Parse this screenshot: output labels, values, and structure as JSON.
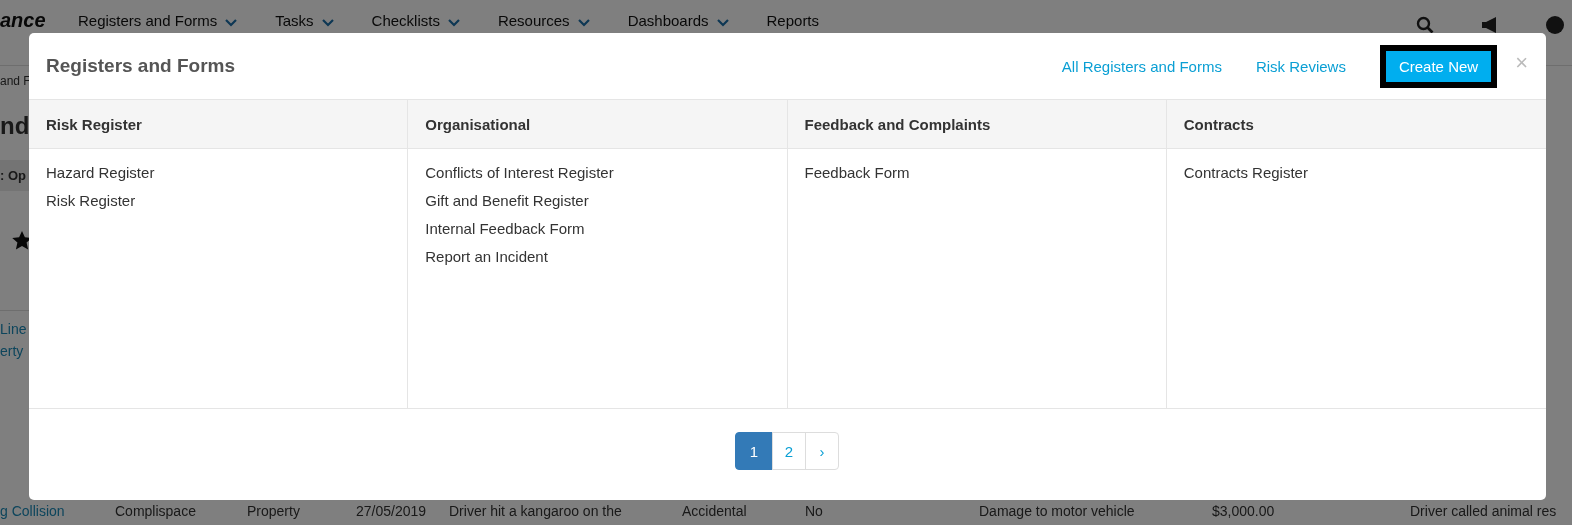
{
  "background": {
    "logo": "ance",
    "nav": [
      {
        "label": "Registers and Forms",
        "dropdown": true
      },
      {
        "label": "Tasks",
        "dropdown": true
      },
      {
        "label": "Checklists",
        "dropdown": true
      },
      {
        "label": "Resources",
        "dropdown": true
      },
      {
        "label": "Dashboards",
        "dropdown": true
      },
      {
        "label": "Reports",
        "dropdown": false
      }
    ],
    "breadcrumb": "and F",
    "heading": "nd",
    "filter": ": Op",
    "links": [
      "Line",
      "erty"
    ],
    "row": [
      "g Collision",
      "Complispace",
      "Property",
      "27/05/2019",
      "Driver hit a kangaroo on the",
      "Accidental",
      "No",
      "Damage to motor vehicle",
      "$3,000.00",
      "Driver called animal res"
    ]
  },
  "modal": {
    "title": "Registers and Forms",
    "links": [
      "All Registers and Forms",
      "Risk Reviews"
    ],
    "button": "Create New",
    "close": "×",
    "columns": [
      {
        "heading": "Risk Register",
        "items": [
          "Hazard Register",
          "Risk Register"
        ]
      },
      {
        "heading": "Organisational",
        "items": [
          "Conflicts of Interest Register",
          "Gift and Benefit Register",
          "Internal Feedback Form",
          "Report an Incident"
        ]
      },
      {
        "heading": "Feedback and Complaints",
        "items": [
          "Feedback Form"
        ]
      },
      {
        "heading": "Contracts",
        "items": [
          "Contracts Register"
        ]
      }
    ],
    "pages": [
      {
        "label": "1",
        "selected": true
      },
      {
        "label": "2",
        "selected": false
      },
      {
        "label": "›",
        "selected": false
      }
    ]
  }
}
